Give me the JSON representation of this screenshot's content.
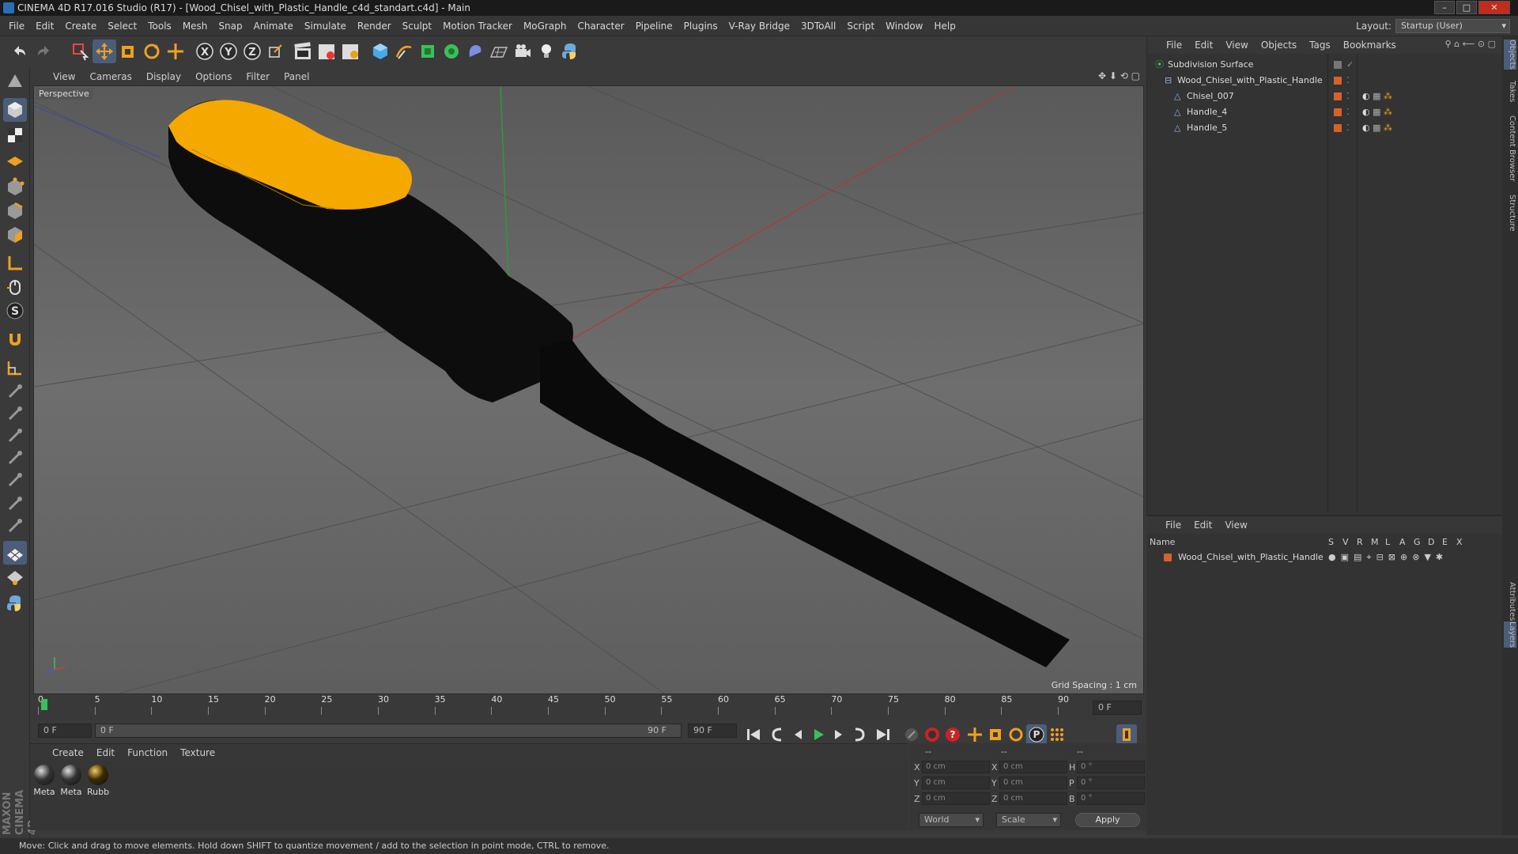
{
  "window": {
    "title": "CINEMA 4D R17.016 Studio (R17) - [Wood_Chisel_with_Plastic_Handle_c4d_standart.c4d] - Main"
  },
  "menubar": {
    "items": [
      "File",
      "Edit",
      "Create",
      "Select",
      "Tools",
      "Mesh",
      "Snap",
      "Animate",
      "Simulate",
      "Render",
      "Sculpt",
      "Motion Tracker",
      "MoGraph",
      "Character",
      "Pipeline",
      "Plugins",
      "V-Ray Bridge",
      "3DToAll",
      "Script",
      "Window",
      "Help"
    ],
    "layout_label": "Layout:",
    "layout_value": "Startup (User)"
  },
  "viewport": {
    "menu": [
      "View",
      "Cameras",
      "Display",
      "Options",
      "Filter",
      "Panel"
    ],
    "label": "Perspective",
    "grid_spacing": "Grid Spacing : 1 cm"
  },
  "timeline": {
    "ticks": [
      "0",
      "5",
      "10",
      "15",
      "20",
      "25",
      "30",
      "35",
      "40",
      "45",
      "50",
      "55",
      "60",
      "65",
      "70",
      "75",
      "80",
      "85",
      "90"
    ],
    "end_field": "0 F"
  },
  "transport": {
    "current_frame": "0 F",
    "range_start": "0 F",
    "range_end": "90 F",
    "max_frame": "90 F"
  },
  "material_manager": {
    "menu": [
      "Create",
      "Edit",
      "Function",
      "Texture"
    ],
    "materials": [
      "Meta",
      "Meta",
      "Rubb"
    ]
  },
  "coordinates": {
    "headers": [
      "--",
      "--",
      "--"
    ],
    "rows": [
      {
        "pos_label": "X",
        "pos": "0 cm",
        "size_label": "X",
        "size": "0 cm",
        "rot_label": "H",
        "rot": "0 °"
      },
      {
        "pos_label": "Y",
        "pos": "0 cm",
        "size_label": "Y",
        "size": "0 cm",
        "rot_label": "P",
        "rot": "0 °"
      },
      {
        "pos_label": "Z",
        "pos": "0 cm",
        "size_label": "Z",
        "size": "0 cm",
        "rot_label": "B",
        "rot": "0 °"
      }
    ],
    "mode_select": "World",
    "scale_select": "Scale",
    "apply_label": "Apply"
  },
  "object_manager": {
    "menu": [
      "File",
      "Edit",
      "View",
      "Objects",
      "Tags",
      "Bookmarks"
    ],
    "objects": [
      {
        "name": "Subdivision Surface",
        "indent": 0
      },
      {
        "name": "Wood_Chisel_with_Plastic_Handle",
        "indent": 1
      },
      {
        "name": "Chisel_007",
        "indent": 2
      },
      {
        "name": "Handle_4",
        "indent": 2
      },
      {
        "name": "Handle_5",
        "indent": 2
      }
    ]
  },
  "layer_manager": {
    "menu": [
      "File",
      "Edit",
      "View"
    ],
    "name_header": "Name",
    "column_headers": [
      "S",
      "V",
      "R",
      "M",
      "L",
      "A",
      "G",
      "D",
      "E",
      "X"
    ],
    "layers": [
      "Wood_Chisel_with_Plastic_Handle"
    ]
  },
  "right_tabs": [
    "Objects",
    "Takes",
    "Content Browser",
    "Structure",
    "Attributes",
    "Layers"
  ],
  "maxon_logo": "MAXON CINEMA 4D",
  "status_bar": "Move: Click and drag to move elements. Hold down SHIFT to quantize movement / add to the selection in point mode, CTRL to remove.",
  "colors": {
    "accent_orange": "#e8a317",
    "handle_black": "#0d0d0d",
    "layer_orange": "#d4622a"
  }
}
